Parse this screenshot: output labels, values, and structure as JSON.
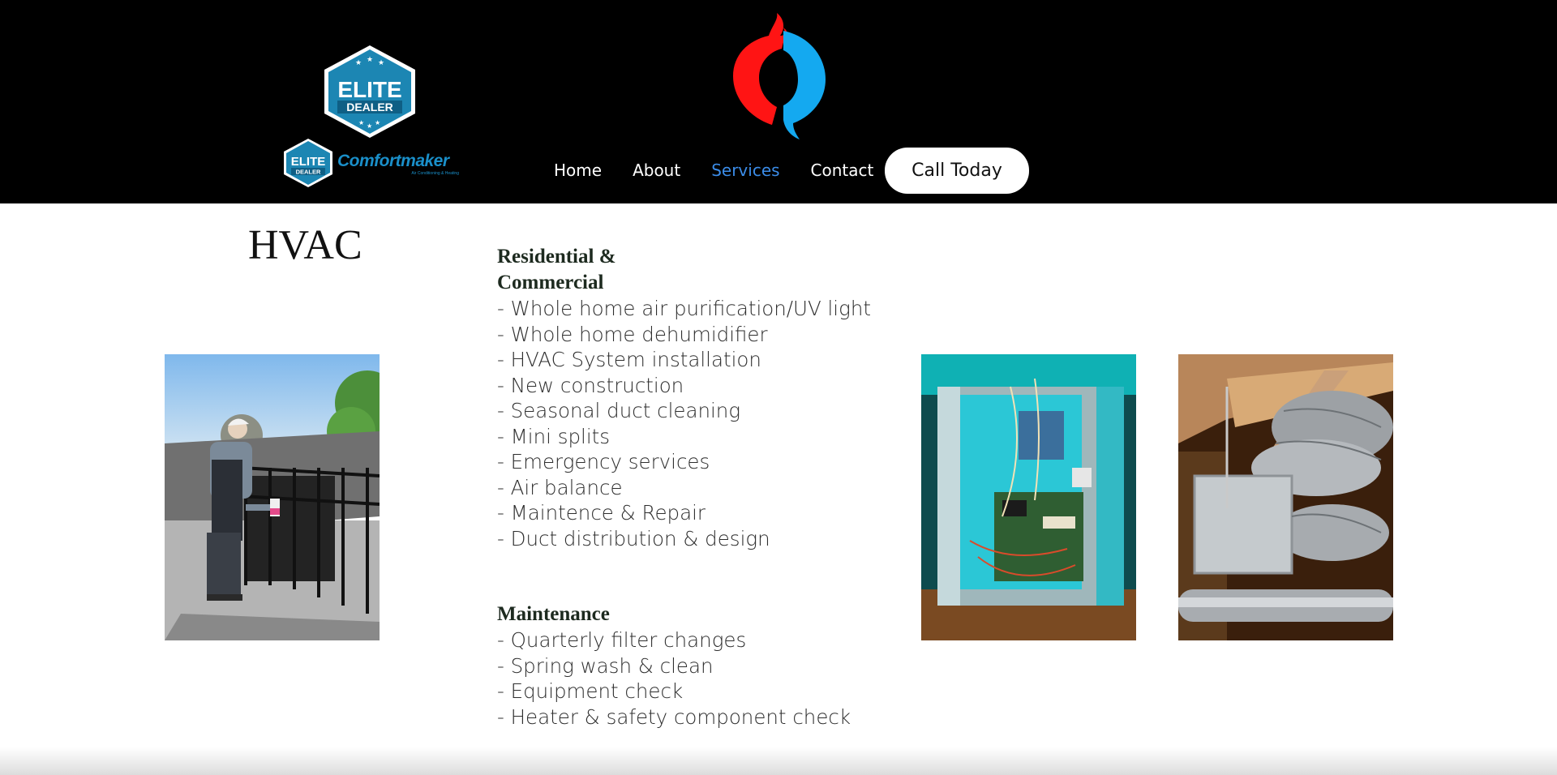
{
  "header": {
    "badge_large": {
      "line1": "ELITE",
      "line2": "DEALER"
    },
    "badge_small": {
      "line1": "ELITE",
      "line2": "DEALER"
    },
    "brand": {
      "name": "Comfortmaker",
      "tagline": "Air Conditioning & Heating"
    },
    "logo_colors": {
      "flame": "#ff1414",
      "water": "#14a9f0"
    }
  },
  "nav": {
    "items": [
      {
        "label": "Home"
      },
      {
        "label": "About"
      },
      {
        "label": "Services",
        "active": true
      },
      {
        "label": "Contact"
      }
    ],
    "cta": "Call Today",
    "active_color": "#3b8ce8"
  },
  "main": {
    "title": "HVAC",
    "sections": [
      {
        "heading_line1": "Residential &",
        "heading_line2": "Commercial",
        "items": [
          "- Whole home air purification/UV light",
          "- Whole home dehumidifier",
          "- HVAC System installation",
          "- New construction",
          "- Seasonal duct cleaning",
          "- Mini splits",
          "- Emergency services",
          "- Air balance",
          "- Maintence & Repair",
          "- Duct distribution & design"
        ]
      },
      {
        "heading": "Maintenance",
        "items": [
          "- Quarterly filter changes",
          "- Spring wash & clean",
          "- Equipment check",
          "- Heater & safety component check"
        ]
      }
    ]
  }
}
